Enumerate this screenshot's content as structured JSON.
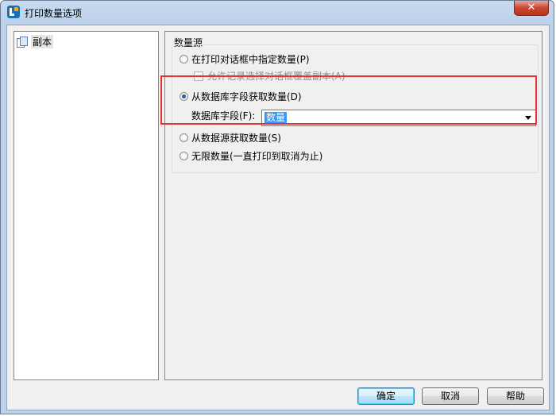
{
  "window": {
    "title": "打印数量选项",
    "close_label": "✕"
  },
  "tree": {
    "items": [
      {
        "label": "副本"
      }
    ]
  },
  "quantity_source": {
    "group_title": "数量源",
    "option_print_dialog": "在打印对话框中指定数量(P)",
    "option_allow_record_override": "允许记录选择对话框覆盖副本(A)",
    "option_from_db_field": "从数据库字段获取数量(D)",
    "db_field_label": "数据库字段(F):",
    "db_field_value": "数量",
    "option_from_datasource": "从数据源获取数量(S)",
    "option_unlimited": "无限数量(一直打印到取消为止)",
    "selected": "从数据库字段获取数量(D)"
  },
  "buttons": {
    "ok": "确定",
    "cancel": "取消",
    "help": "帮助"
  },
  "colors": {
    "highlight_border": "#e53333",
    "selection": "#3399ff"
  }
}
